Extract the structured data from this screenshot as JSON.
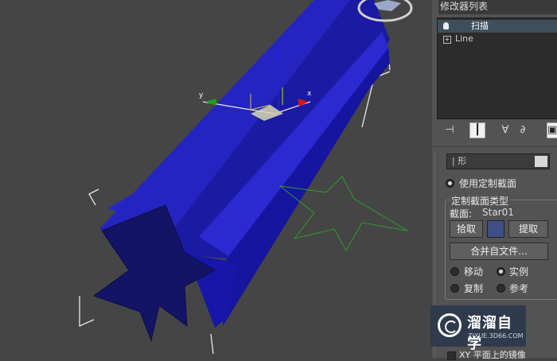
{
  "panel": {
    "title": "修改器列表",
    "stack": {
      "items": [
        {
          "label": "扫描",
          "icon": "bulb-icon",
          "selected": true
        },
        {
          "label": "Line",
          "icon": "plus-icon",
          "selected": false
        }
      ]
    },
    "toolbar": {
      "icons": [
        "pin-stack-icon",
        "show-end-result-icon",
        "make-unique-icon",
        "remove-modifier-icon",
        "configure-modifier-sets-icon"
      ]
    },
    "shape_dropdown_value": "| 形",
    "use_custom_section": "使用定制截面",
    "custom_section_group": {
      "title": "定制截面类型",
      "section_label": "截面:",
      "section_value": "Star01",
      "pick_button": "拾取",
      "extract_button": "提取",
      "merge_file_button": "合并自文件...",
      "options": [
        {
          "label": "移动",
          "selected": false
        },
        {
          "label": "实例",
          "selected": true
        },
        {
          "label": "复制",
          "selected": false
        },
        {
          "label": "参考",
          "selected": false
        }
      ]
    },
    "mirror_label": "XY 平面上的镜像"
  },
  "viewport": {
    "gizmo_axes": {
      "x": "x",
      "y": "y"
    },
    "colors": {
      "background": "#454545",
      "sweep_object": "#1f1fb0",
      "section_spline": "#2e9c2e",
      "axis_x": "#d01818",
      "axis_y": "#18a018",
      "axis_z": "#2020e0"
    }
  },
  "watermark": {
    "text": "溜溜自学",
    "url": "ZIXUE.3D66.COM"
  }
}
